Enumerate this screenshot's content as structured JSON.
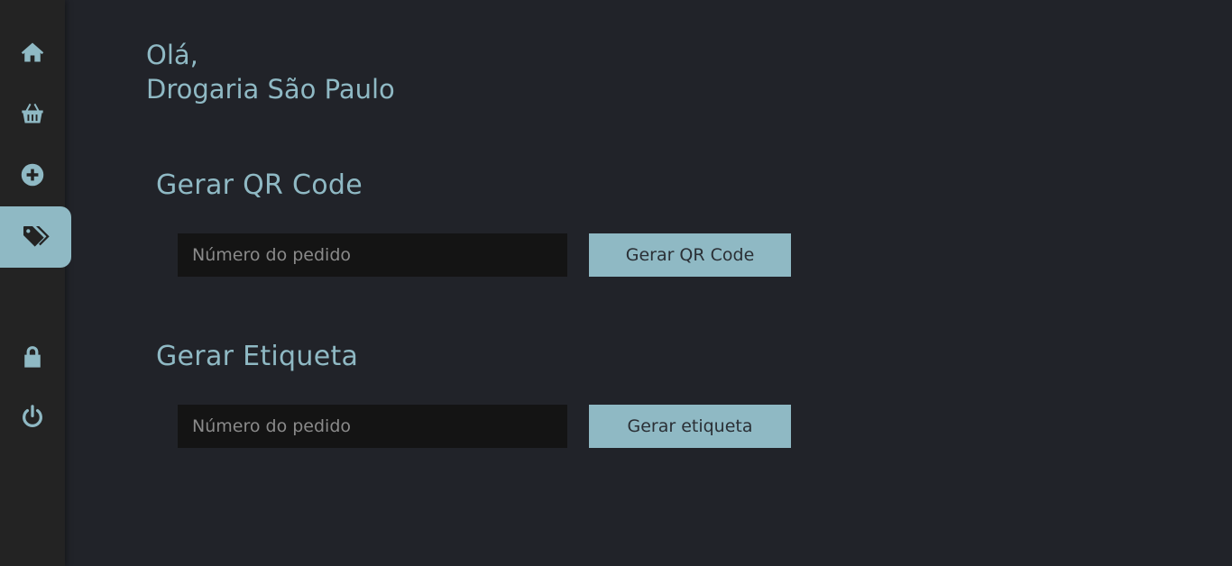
{
  "sidebar": {
    "icon_color": "#8fb9c4",
    "active_color": "#8fb9c4",
    "items": [
      {
        "icon": "home-icon"
      },
      {
        "icon": "basket-icon"
      },
      {
        "icon": "plus-circle-icon"
      },
      {
        "icon": "tags-icon",
        "active": true
      },
      {
        "icon": "lock-icon"
      },
      {
        "icon": "power-icon"
      }
    ]
  },
  "greeting": {
    "hello": "Olá,",
    "name": "Drogaria São Paulo"
  },
  "qr_section": {
    "title": "Gerar QR Code",
    "input_placeholder": "Número do pedido",
    "input_value": "",
    "button_label": "Gerar QR Code"
  },
  "label_section": {
    "title": "Gerar Etiqueta",
    "input_placeholder": "Número do pedido",
    "input_value": "",
    "button_label": "Gerar etiqueta"
  },
  "colors": {
    "accent": "#8fb9c4",
    "background": "#212329",
    "sidebar": "#232323",
    "input_bg": "#141414"
  }
}
